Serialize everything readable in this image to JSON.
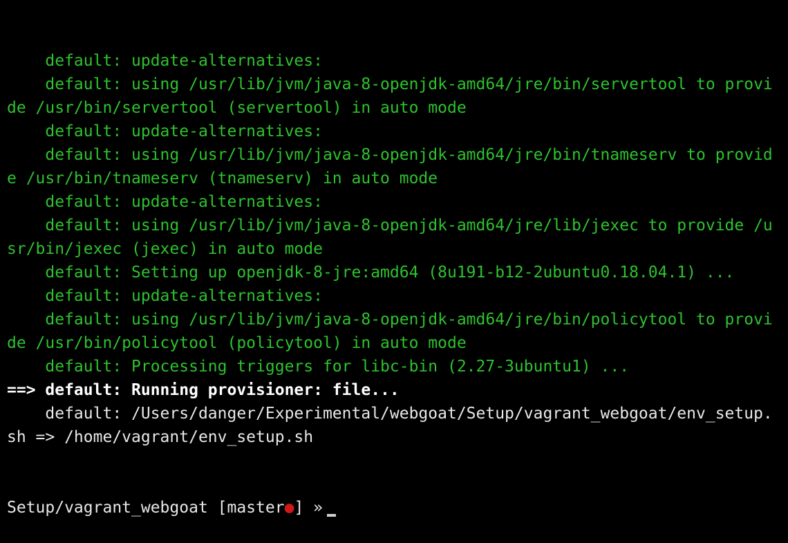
{
  "colors": {
    "background": "#000000",
    "output_green": "#2ec22e",
    "output_white": "#e8e8e8",
    "prompt_dot_red": "#d01818"
  },
  "lines": [
    {
      "text": "    default: update-alternatives:",
      "style": "green"
    },
    {
      "text": "    default: using /usr/lib/jvm/java-8-openjdk-amd64/jre/bin/servertool to provi",
      "style": "green"
    },
    {
      "text": "de /usr/bin/servertool (servertool) in auto mode",
      "style": "green"
    },
    {
      "text": "    default: update-alternatives:",
      "style": "green"
    },
    {
      "text": "    default: using /usr/lib/jvm/java-8-openjdk-amd64/jre/bin/tnameserv to provid",
      "style": "green"
    },
    {
      "text": "e /usr/bin/tnameserv (tnameserv) in auto mode",
      "style": "green"
    },
    {
      "text": "    default: update-alternatives:",
      "style": "green"
    },
    {
      "text": "    default: using /usr/lib/jvm/java-8-openjdk-amd64/jre/lib/jexec to provide /u",
      "style": "green"
    },
    {
      "text": "sr/bin/jexec (jexec) in auto mode",
      "style": "green"
    },
    {
      "text": "    default: Setting up openjdk-8-jre:amd64 (8u191-b12-2ubuntu0.18.04.1) ...",
      "style": "green"
    },
    {
      "text": "    default: update-alternatives:",
      "style": "green"
    },
    {
      "text": "    default: using /usr/lib/jvm/java-8-openjdk-amd64/jre/bin/policytool to provi",
      "style": "green"
    },
    {
      "text": "de /usr/bin/policytool (policytool) in auto mode",
      "style": "green"
    },
    {
      "text": "    default: Processing triggers for libc-bin (2.27-3ubuntu1) ...",
      "style": "green"
    },
    {
      "text": "==> default: Running provisioner: file...",
      "style": "bold"
    },
    {
      "text": "    default: /Users/danger/Experimental/webgoat/Setup/vagrant_webgoat/env_setup.",
      "style": "white"
    },
    {
      "text": "sh => /home/vagrant/env_setup.sh",
      "style": "white"
    }
  ],
  "prompt": {
    "path": "Setup/vagrant_webgoat",
    "branch_open": " [master",
    "dirty_marker": "●",
    "branch_close": "]",
    "symbol": " »"
  }
}
